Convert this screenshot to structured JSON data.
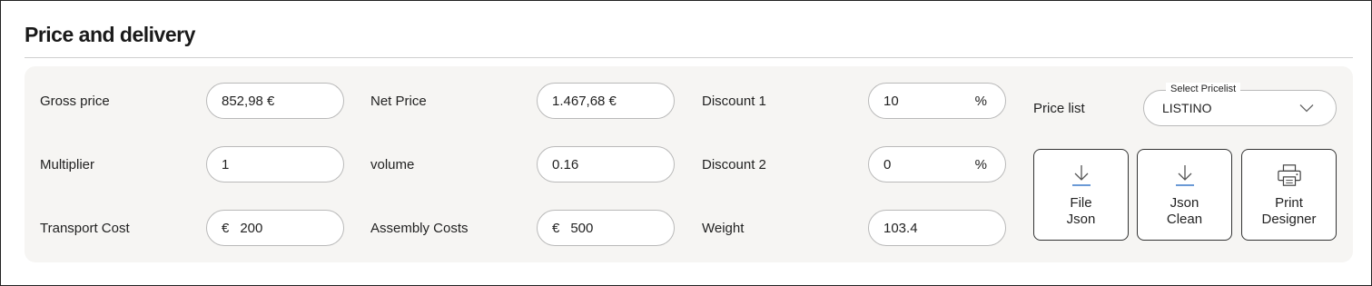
{
  "section": {
    "title": "Price and delivery"
  },
  "fields": {
    "gross_price": {
      "label": "Gross price",
      "value": "852,98 €"
    },
    "net_price": {
      "label": "Net Price",
      "value": "1.467,68 €"
    },
    "discount1": {
      "label": "Discount 1",
      "value": "10",
      "suffix": "%"
    },
    "multiplier": {
      "label": "Multiplier",
      "value": "1"
    },
    "volume": {
      "label": "volume",
      "value": "0.16"
    },
    "discount2": {
      "label": "Discount 2",
      "value": "0",
      "suffix": "%"
    },
    "transport_cost": {
      "label": "Transport Cost",
      "prefix": "€",
      "value": "200"
    },
    "assembly_costs": {
      "label": "Assembly Costs",
      "prefix": "€",
      "value": "500"
    },
    "weight": {
      "label": "Weight",
      "value": "103.4"
    }
  },
  "pricelist": {
    "label": "Price list",
    "legend": "Select Pricelist",
    "selected": "LISTINO",
    "icon": "chevron-down-icon"
  },
  "actions": [
    {
      "label": "File\nJson",
      "icon": "download-icon"
    },
    {
      "label": "Json\nClean",
      "icon": "download-icon"
    },
    {
      "label": "Print\nDesigner",
      "icon": "printer-icon"
    }
  ],
  "colors": {
    "panel_bg": "#f6f5f3",
    "accent_blue": "#3a78c9",
    "border": "#b9b9b9"
  }
}
